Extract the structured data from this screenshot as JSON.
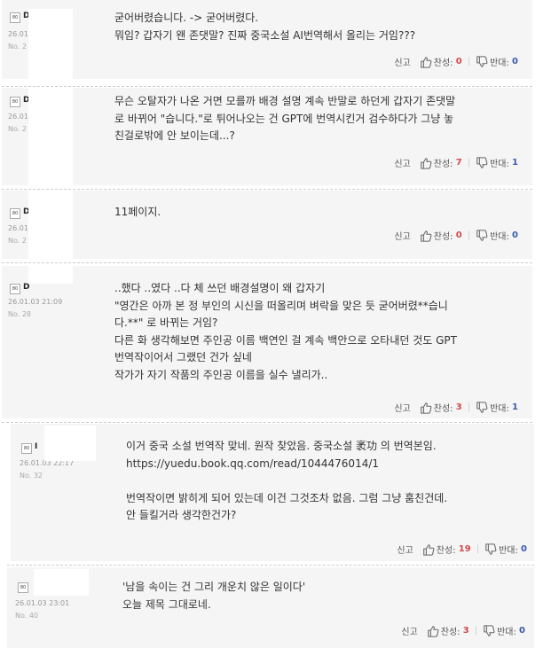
{
  "labels": {
    "report": "신고",
    "up": "찬성:",
    "down": "반대:"
  },
  "comments": [
    {
      "level_badge": "80",
      "nick": "D",
      "date": "26.01",
      "no": "No. 2",
      "lines": [
        "굳어버렸습니다. -> 굳어버렸다.",
        "뭐임? 갑자기 왠 존댓말? 진짜 중국소설 AI번역해서 올리는 거임???"
      ],
      "up": "0",
      "down": "0"
    },
    {
      "level_badge": "80",
      "nick": "D",
      "date": "26.01",
      "no": "No. 2",
      "lines": [
        "무슨 오탈자가 나온 거면 모를까 배경 설명 계속 반말로 하던게 갑자기 존댓말",
        "로 바뀌어 \"습니다.\"로 튀어나오는 건 GPT에 번역시킨거 검수하다가 그냥 놓",
        "친걸로밖에 안 보이는데...?"
      ],
      "up": "7",
      "down": "1"
    },
    {
      "level_badge": "80",
      "nick": "D",
      "date": "26.01",
      "no": "No. 2",
      "lines": [
        "11페이지."
      ],
      "up": "0",
      "down": "0"
    },
    {
      "level_badge": "80",
      "nick": "D",
      "date": "26.01.03 21:09",
      "no": "No. 28",
      "lines": [
        "..했다 ..였다 ..다 체 쓰던 배경설명이 왜 갑자기",
        "\"영간은 아까 본 정 부인의 시신을 떠올리며 벼락을 맞은 듯 굳어버렸**습니",
        "다.**\" 로 바뀌는 거임?",
        "다른 화 생각해보면 주인공 이름 백연인 걸 계속 백안으로 오타내던 것도 GPT",
        "번역작이어서 그랬던 건가 싶네",
        "작가가 자기 작품의 주인공 이름을 실수 낼리가.."
      ],
      "up": "3",
      "down": "1"
    },
    {
      "level_badge": "80",
      "nick": "I",
      "date": "26.01.03 22:17",
      "no": "No. 32",
      "lines": [
        "이거 중국 소설 번역작 맞네. 원작 찾았음. 중국소설 袤功 의 번역본임.",
        "https://yuedu.book.qq.com/read/1044476014/1",
        "",
        "번역작이면 밝히게 되어 있는데 이건 그것조차 없음. 그럼 그냥 훔친건데.",
        "안 들킬거라 생각한건가?"
      ],
      "up": "19",
      "down": "0"
    },
    {
      "level_badge": "80",
      "nick": "",
      "date": "26.01.03 23:01",
      "no": "No. 40",
      "lines": [
        "'남을 속이는 건 그리 개운치 않은 일이다'",
        "오늘 제목 그대로네."
      ],
      "up": "3",
      "down": "0"
    }
  ]
}
